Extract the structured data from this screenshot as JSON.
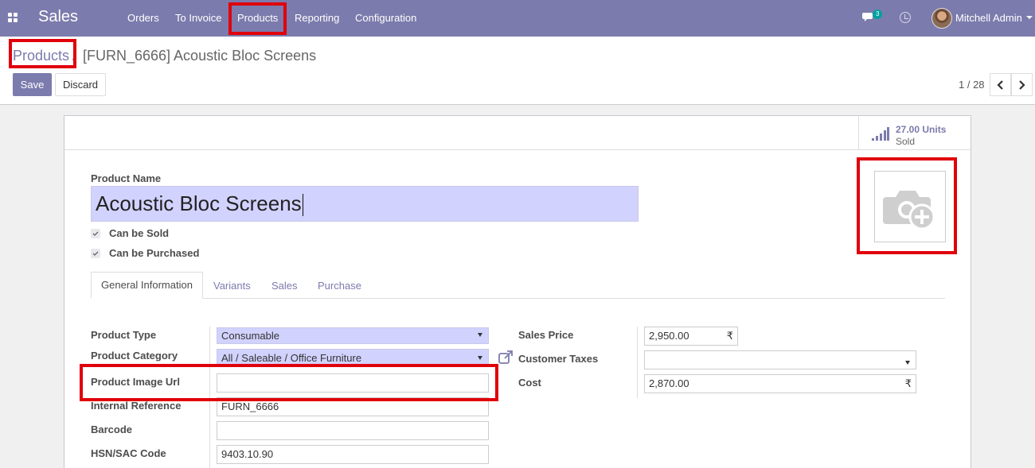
{
  "navbar": {
    "app_name": "Sales",
    "menu": [
      "Orders",
      "To Invoice",
      "Products",
      "Reporting",
      "Configuration"
    ],
    "chat_badge": "3",
    "user_name": "Mitchell Admin",
    "icons": {
      "apps": "apps-grid-icon",
      "chat": "chat-icon",
      "activity": "clock-icon"
    }
  },
  "breadcrumb": {
    "parent": "Products",
    "separator": "/",
    "current": "[FURN_6666] Acoustic Bloc Screens"
  },
  "buttons": {
    "save": "Save",
    "discard": "Discard"
  },
  "pager": {
    "value": "1 / 28"
  },
  "stat_button": {
    "value": "27.00 Units",
    "label": "Sold"
  },
  "product": {
    "name_label": "Product Name",
    "name": "Acoustic Bloc Screens",
    "can_be_sold": "Can be Sold",
    "can_be_purchased": "Can be Purchased"
  },
  "tabs": [
    "General Information",
    "Variants",
    "Sales",
    "Purchase"
  ],
  "general": {
    "product_type": {
      "label": "Product Type",
      "value": "Consumable"
    },
    "product_category": {
      "label": "Product Category",
      "value": "All / Saleable / Office Furniture"
    },
    "product_image_url": {
      "label": "Product Image Url",
      "value": ""
    },
    "internal_reference": {
      "label": "Internal Reference",
      "value": "FURN_6666"
    },
    "barcode": {
      "label": "Barcode",
      "value": ""
    },
    "hsn_sac": {
      "label": "HSN/SAC Code",
      "value": "9403.10.90"
    },
    "sales_price": {
      "label": "Sales Price",
      "value": "2,950.00",
      "currency": "₹"
    },
    "customer_taxes": {
      "label": "Customer Taxes",
      "value": ""
    },
    "cost": {
      "label": "Cost",
      "value": "2,870.00",
      "currency": "₹"
    }
  },
  "colors": {
    "brand": "#7c7bad",
    "highlight": "#e0000b",
    "required_field": "#d2d2ff"
  }
}
